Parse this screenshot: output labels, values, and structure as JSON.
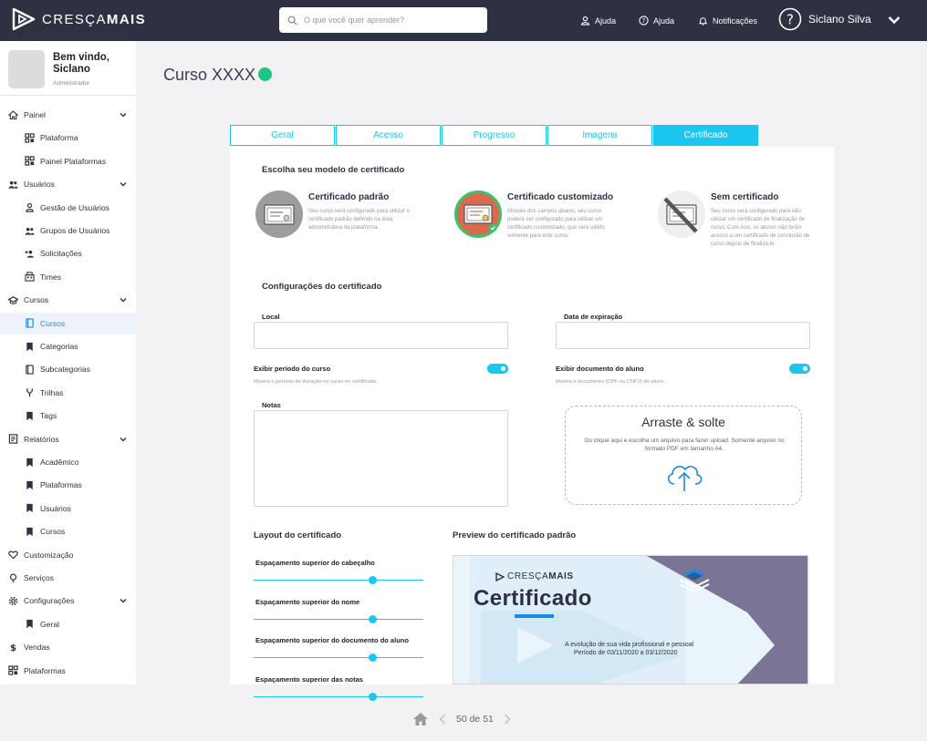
{
  "brand": {
    "name_light": "CRESÇA",
    "name_bold": "MAIS"
  },
  "search": {
    "placeholder": "O que você quer aprender?"
  },
  "topnav": {
    "help1": "Ajuda",
    "help2": "Ajuda",
    "notifications": "Notificações",
    "user_name": "Siclano Silva"
  },
  "sidebar": {
    "welcome": "Bem vindo, Siclano",
    "role": "Administrador",
    "items": [
      {
        "label": "Painel",
        "icon": "home-icon",
        "level": "top",
        "expanded": true
      },
      {
        "label": "Plataforma",
        "icon": "grid-icon",
        "level": "sub"
      },
      {
        "label": "Painel Plataformas",
        "icon": "grid-icon",
        "level": "sub"
      },
      {
        "label": "Usuários",
        "icon": "users-icon",
        "level": "top",
        "expanded": true
      },
      {
        "label": "Gestão de Usuários",
        "icon": "user-icon",
        "level": "sub"
      },
      {
        "label": "Grupos de Usuários",
        "icon": "users-icon",
        "level": "sub"
      },
      {
        "label": "Solicitações",
        "icon": "user-add-icon",
        "level": "sub"
      },
      {
        "label": "Times",
        "icon": "team-icon",
        "level": "sub"
      },
      {
        "label": "Cursos",
        "icon": "graduation-cap-icon",
        "level": "top",
        "expanded": true
      },
      {
        "label": "Cursos",
        "icon": "book-icon",
        "level": "sub",
        "active": true
      },
      {
        "label": "Categorias",
        "icon": "bookmark-icon",
        "level": "sub"
      },
      {
        "label": "Subcategorias",
        "icon": "book-outline-icon",
        "level": "sub"
      },
      {
        "label": "Trilhas",
        "icon": "branch-icon",
        "level": "sub"
      },
      {
        "label": "Tags",
        "icon": "bookmark-icon",
        "level": "sub"
      },
      {
        "label": "Relatórios",
        "icon": "report-icon",
        "level": "top",
        "expanded": true
      },
      {
        "label": "Acadêmico",
        "icon": "bookmark-icon",
        "level": "sub"
      },
      {
        "label": "Plataformas",
        "icon": "bookmark-icon",
        "level": "sub"
      },
      {
        "label": "Usuários",
        "icon": "bookmark-icon",
        "level": "sub"
      },
      {
        "label": "Cursos",
        "icon": "bookmark-icon",
        "level": "sub"
      },
      {
        "label": "Customização",
        "icon": "heart-icon",
        "level": "top"
      },
      {
        "label": "Serviços",
        "icon": "bulb-icon",
        "level": "top"
      },
      {
        "label": "Configurações",
        "icon": "gear-icon",
        "level": "top",
        "expanded": true
      },
      {
        "label": "Geral",
        "icon": "bookmark-icon",
        "level": "sub"
      },
      {
        "label": "Vendas",
        "icon": "dollar-icon",
        "level": "top"
      },
      {
        "label": "Plataformas",
        "icon": "grid-icon",
        "level": "top"
      }
    ]
  },
  "page": {
    "title": "Curso XXXX",
    "status_color": "#1dc685"
  },
  "tabs": [
    {
      "label": "Geral"
    },
    {
      "label": "Acesso"
    },
    {
      "label": "Progresso"
    },
    {
      "label": "Imagens"
    },
    {
      "label": "Certificado",
      "active": true
    }
  ],
  "certificate_models": {
    "title": "Escolha seu modelo de certificado",
    "options": [
      {
        "title": "Certificado padrão",
        "description": "Seu curso será configurado para utilizar o certificado padrão definido na área administrativa da plataforma."
      },
      {
        "title": "Certificado customizado",
        "description": "Através dos campos abaixo, seu curso poderá ser configurado para utilizar um certificado customizado, que será válido somente para este curso.",
        "selected": true
      },
      {
        "title": "Sem certificado",
        "description": "Seu curso será configurado para não utilizar um certificado de finalização de curso. Com isso, os alunos não terão acesso a um certificado de conclusão de curso depois de finalizá-lo."
      }
    ]
  },
  "config": {
    "title": "Configurações do certificado",
    "local_label": "Local",
    "expiration_label": "Data de expiração",
    "period_label": "Exibir período do curso",
    "period_hint": "Mostra o período de duração no curso no certificado.",
    "period_on": true,
    "document_label": "Exibir documento do aluno",
    "document_hint": "Mostra o documento (CPF ou CNPJ) do aluno.",
    "document_on": true,
    "notes_label": "Notas"
  },
  "upload": {
    "title": "Arraste & solte",
    "text": "Ou clique aqui e escolha um arquivo para fazer upload. Somente arquivo no formato PDF em tamanho A4."
  },
  "layout": {
    "title": "Layout do certificado",
    "sliders": [
      {
        "label": "Espaçamento superior do cabeçalho",
        "value": 0.7
      },
      {
        "label": "Espaçamento superior do nome",
        "value": 0.7
      },
      {
        "label": "Espaçamento superior do documento do aluno",
        "value": 0.7
      },
      {
        "label": "Espaçamento superior das notas",
        "value": 0.7
      }
    ]
  },
  "preview": {
    "title": "Preview do certificado padrão",
    "logo_light": "CRESÇA",
    "logo_bold": "MAIS",
    "heading": "Certificado",
    "line1": "A evolução de sua vida profissional e pessoal",
    "line2": "Período de 03/11/2020 a 03/12/2020"
  },
  "pagination": {
    "text": "50 de 51"
  }
}
